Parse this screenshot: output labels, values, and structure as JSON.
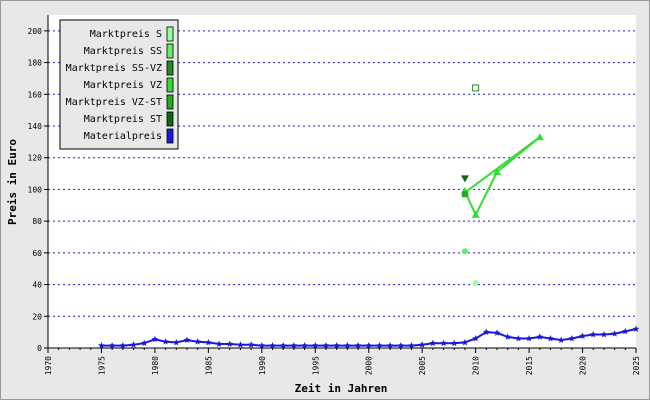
{
  "chart_data": {
    "type": "line",
    "xlabel": "Zeit in Jahren",
    "ylabel": "Preis in Euro",
    "xlim": [
      1970,
      2025
    ],
    "ylim": [
      0,
      210
    ],
    "x_ticks": [
      1970,
      1975,
      1980,
      1985,
      1990,
      1995,
      2000,
      2005,
      2010,
      2015,
      2020,
      2025
    ],
    "y_ticks": [
      0,
      20,
      40,
      60,
      80,
      100,
      120,
      140,
      160,
      180,
      200
    ],
    "grid": "horizontal dotted",
    "legend_position": "top-left",
    "series": [
      {
        "name": "Marktpreis S",
        "color": "#99ff99",
        "marker": "dot",
        "points": [
          [
            2010,
            41
          ]
        ]
      },
      {
        "name": "Marktpreis SS",
        "color": "#66ee66",
        "marker": "dot",
        "points": [
          [
            2009,
            61
          ]
        ]
      },
      {
        "name": "Marktpreis SS-VZ",
        "color": "#228822",
        "marker": "square-open",
        "points": [
          [
            2010,
            164
          ]
        ]
      },
      {
        "name": "Marktpreis VZ",
        "color": "#33dd33",
        "marker": "triangle-up",
        "points": [
          [
            2009,
            99
          ],
          [
            2010,
            84
          ],
          [
            2012,
            111
          ],
          [
            2016,
            133
          ],
          [
            2009,
            98
          ]
        ]
      },
      {
        "name": "Marktpreis VZ-ST",
        "color": "#22aa22",
        "marker": "square",
        "points": [
          [
            2009,
            97
          ]
        ]
      },
      {
        "name": "Marktpreis ST",
        "color": "#116611",
        "marker": "triangle-down",
        "points": [
          [
            2009,
            107
          ]
        ]
      },
      {
        "name": "Materialpreis",
        "color": "#1a1adb",
        "marker": "star",
        "points": [
          [
            1975,
            1.5
          ],
          [
            1976,
            1.5
          ],
          [
            1977,
            1.5
          ],
          [
            1978,
            2
          ],
          [
            1979,
            3
          ],
          [
            1980,
            5.5
          ],
          [
            1981,
            4
          ],
          [
            1982,
            3.5
          ],
          [
            1983,
            5
          ],
          [
            1984,
            4
          ],
          [
            1985,
            3.5
          ],
          [
            1986,
            2.5
          ],
          [
            1987,
            2.5
          ],
          [
            1988,
            2
          ],
          [
            1989,
            2
          ],
          [
            1990,
            1.5
          ],
          [
            1991,
            1.5
          ],
          [
            1992,
            1.5
          ],
          [
            1993,
            1.5
          ],
          [
            1994,
            1.5
          ],
          [
            1995,
            1.5
          ],
          [
            1996,
            1.5
          ],
          [
            1997,
            1.5
          ],
          [
            1998,
            1.5
          ],
          [
            1999,
            1.5
          ],
          [
            2000,
            1.5
          ],
          [
            2001,
            1.5
          ],
          [
            2002,
            1.5
          ],
          [
            2003,
            1.5
          ],
          [
            2004,
            1.5
          ],
          [
            2005,
            2
          ],
          [
            2006,
            3
          ],
          [
            2007,
            3
          ],
          [
            2008,
            3
          ],
          [
            2009,
            3.5
          ],
          [
            2010,
            6
          ],
          [
            2011,
            10
          ],
          [
            2012,
            9.5
          ],
          [
            2013,
            7
          ],
          [
            2014,
            6
          ],
          [
            2015,
            6
          ],
          [
            2016,
            7
          ],
          [
            2017,
            6
          ],
          [
            2018,
            5
          ],
          [
            2019,
            6
          ],
          [
            2020,
            7.5
          ],
          [
            2021,
            8.5
          ],
          [
            2022,
            8.5
          ],
          [
            2023,
            9
          ],
          [
            2024,
            10.5
          ],
          [
            2025,
            12
          ]
        ]
      }
    ]
  }
}
